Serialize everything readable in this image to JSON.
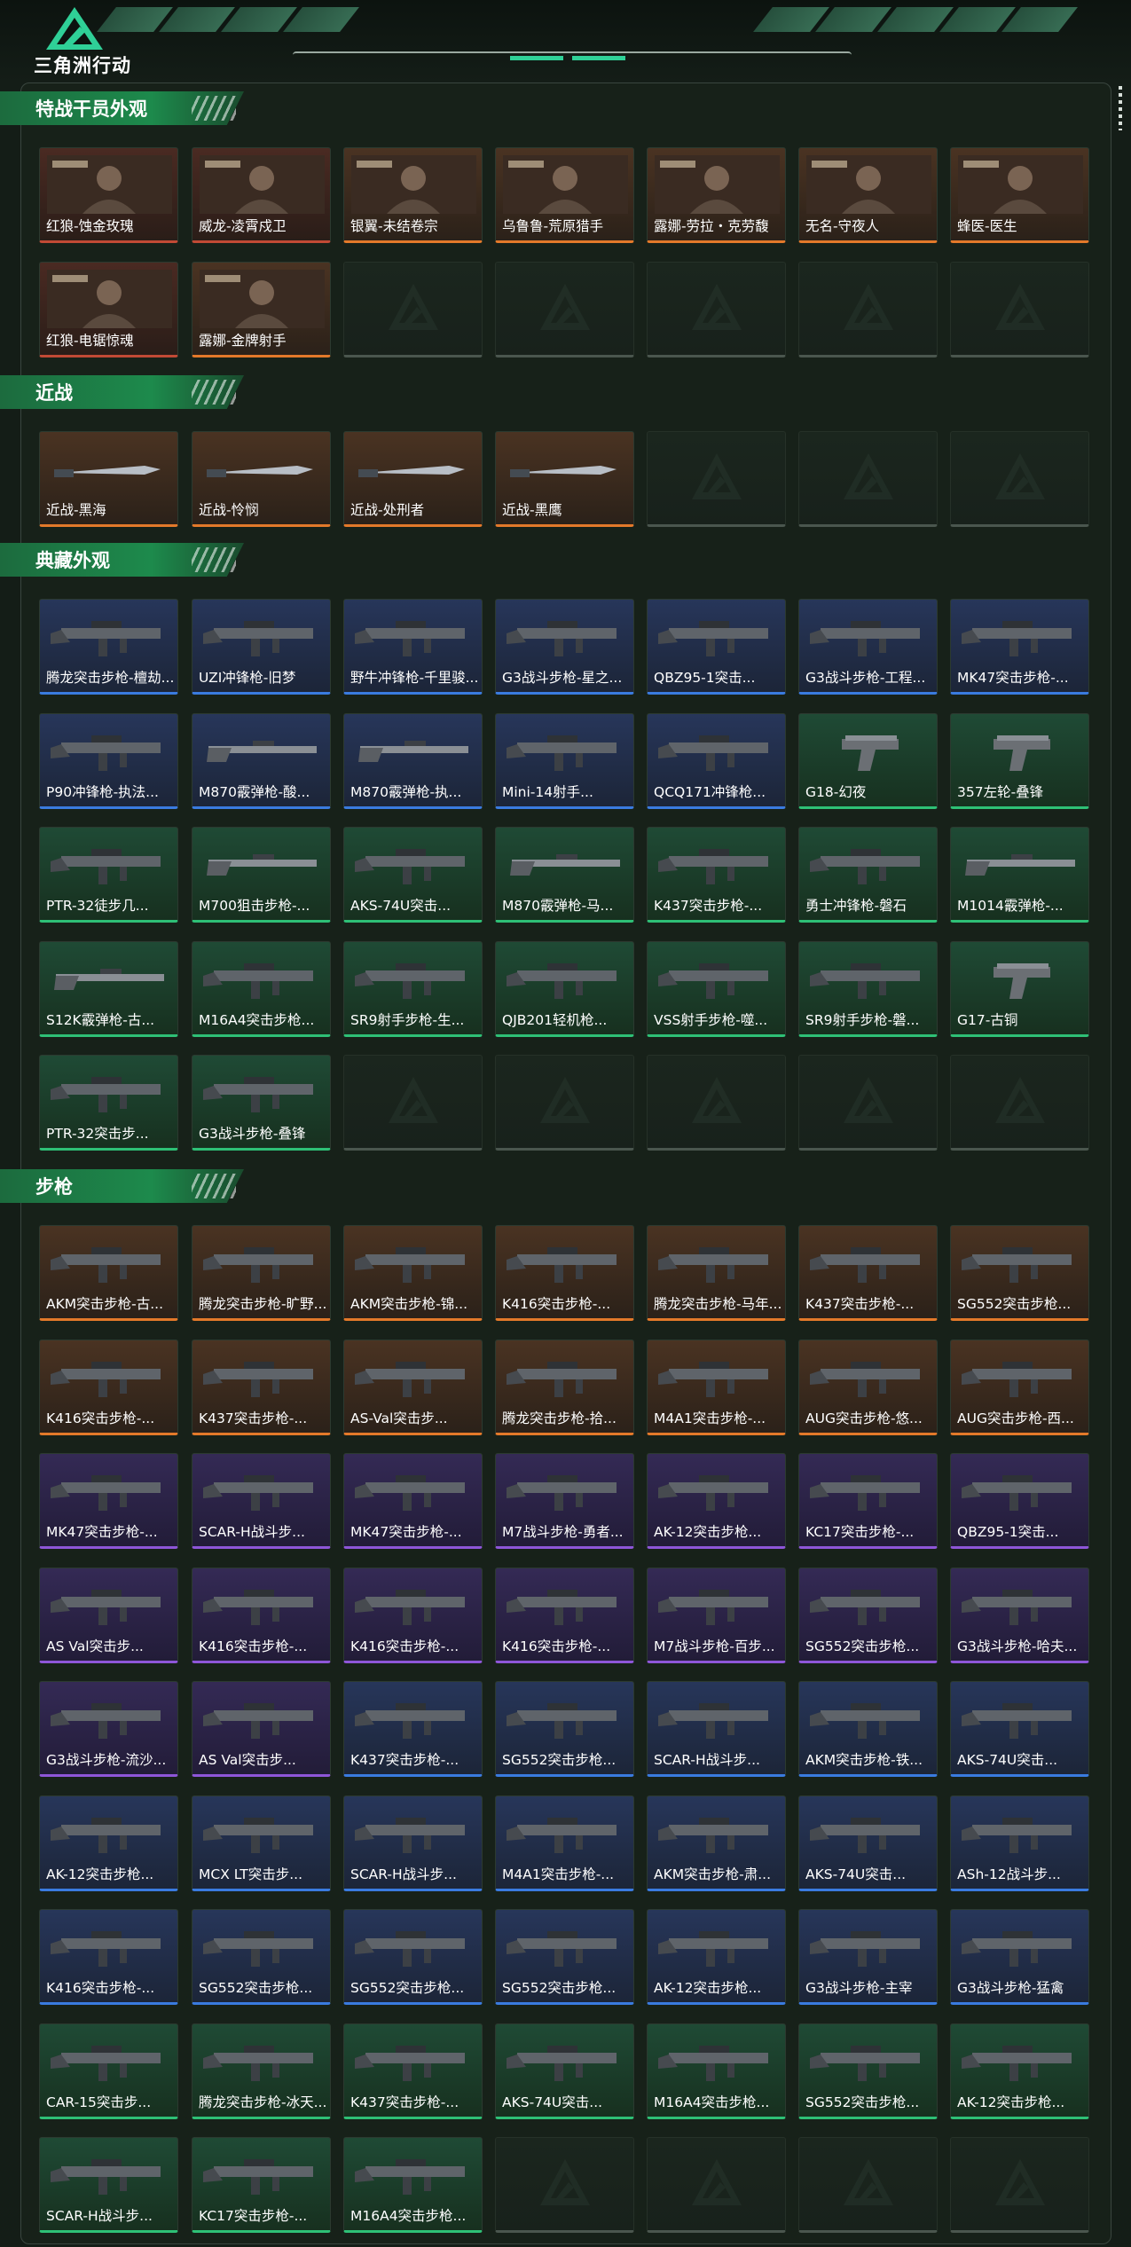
{
  "header": {
    "brand": "三角洲行动",
    "colors": {
      "accent": "#2fd097",
      "stripe": "#3e7b5f"
    }
  },
  "sections": [
    {
      "title": "特战干员外观",
      "columns": 7,
      "slots": 14,
      "items": [
        {
          "label": "红狼-蚀金玫瑰",
          "rarity": "red",
          "icon": "operator-portrait-icon"
        },
        {
          "label": "威龙-凌霄戍卫",
          "rarity": "red",
          "icon": "operator-portrait-icon"
        },
        {
          "label": "银翼-未结卷宗",
          "rarity": "orange",
          "icon": "operator-portrait-icon"
        },
        {
          "label": "乌鲁鲁-荒原猎手",
          "rarity": "orange",
          "icon": "operator-portrait-icon"
        },
        {
          "label": "露娜-劳拉・克劳馥",
          "rarity": "orange",
          "icon": "operator-portrait-icon"
        },
        {
          "label": "无名-守夜人",
          "rarity": "orange",
          "icon": "operator-portrait-icon"
        },
        {
          "label": "蜂医-医生",
          "rarity": "orange",
          "icon": "operator-portrait-icon"
        },
        {
          "label": "红狼-电锯惊魂",
          "rarity": "red",
          "icon": "operator-portrait-icon"
        },
        {
          "label": "露娜-金牌射手",
          "rarity": "orange",
          "icon": "operator-portrait-icon"
        }
      ]
    },
    {
      "title": "近战",
      "columns": 7,
      "slots": 7,
      "items": [
        {
          "label": "近战-黑海",
          "rarity": "orange",
          "icon": "melee-weapon-icon"
        },
        {
          "label": "近战-怜悯",
          "rarity": "orange",
          "icon": "melee-weapon-icon"
        },
        {
          "label": "近战-处刑者",
          "rarity": "orange",
          "icon": "melee-weapon-icon"
        },
        {
          "label": "近战-黑鹰",
          "rarity": "orange",
          "icon": "melee-weapon-icon"
        }
      ]
    },
    {
      "title": "典藏外观",
      "columns": 7,
      "slots": 35,
      "items": [
        {
          "label": "腾龙突击步枪-檀劫...",
          "rarity": "blue",
          "icon": "rifle-icon"
        },
        {
          "label": "UZI冲锋枪-旧梦",
          "rarity": "blue",
          "icon": "smg-icon"
        },
        {
          "label": "野牛冲锋枪-千里骏...",
          "rarity": "blue",
          "icon": "smg-icon"
        },
        {
          "label": "G3战斗步枪-星之...",
          "rarity": "blue",
          "icon": "rifle-icon"
        },
        {
          "label": "QBZ95-1突击...",
          "rarity": "blue",
          "icon": "rifle-icon"
        },
        {
          "label": "G3战斗步枪-工程...",
          "rarity": "blue",
          "icon": "rifle-icon"
        },
        {
          "label": "MK47突击步枪-...",
          "rarity": "blue",
          "icon": "rifle-icon"
        },
        {
          "label": "P90冲锋枪-执法...",
          "rarity": "blue",
          "icon": "smg-icon"
        },
        {
          "label": "M870霰弹枪-酸...",
          "rarity": "blue",
          "icon": "shotgun-icon"
        },
        {
          "label": "M870霰弹枪-执...",
          "rarity": "blue",
          "icon": "shotgun-icon"
        },
        {
          "label": "Mini-14射手...",
          "rarity": "blue",
          "icon": "rifle-icon"
        },
        {
          "label": "QCQ171冲锋枪...",
          "rarity": "blue",
          "icon": "smg-icon"
        },
        {
          "label": "G18-幻夜",
          "rarity": "green",
          "icon": "pistol-icon"
        },
        {
          "label": "357左轮-叠锋",
          "rarity": "green",
          "icon": "revolver-icon"
        },
        {
          "label": "PTR-32徒步几...",
          "rarity": "green",
          "icon": "rifle-icon"
        },
        {
          "label": "M700狙击步枪-...",
          "rarity": "green",
          "icon": "sniper-icon"
        },
        {
          "label": "AKS-74U突击...",
          "rarity": "green",
          "icon": "rifle-icon"
        },
        {
          "label": "M870霰弹枪-马...",
          "rarity": "green",
          "icon": "shotgun-icon"
        },
        {
          "label": "K437突击步枪-...",
          "rarity": "green",
          "icon": "rifle-icon"
        },
        {
          "label": "勇士冲锋枪-磐石",
          "rarity": "green",
          "icon": "smg-icon"
        },
        {
          "label": "M1014霰弹枪-...",
          "rarity": "green",
          "icon": "shotgun-icon"
        },
        {
          "label": "S12K霰弹枪-古...",
          "rarity": "green",
          "icon": "shotgun-icon"
        },
        {
          "label": "M16A4突击步枪...",
          "rarity": "green",
          "icon": "rifle-icon"
        },
        {
          "label": "SR9射手步枪-生...",
          "rarity": "green",
          "icon": "rifle-icon"
        },
        {
          "label": "QJB201轻机枪...",
          "rarity": "green",
          "icon": "lmg-icon"
        },
        {
          "label": "VSS射手步枪-噬...",
          "rarity": "green",
          "icon": "rifle-icon"
        },
        {
          "label": "SR9射手步枪-磐...",
          "rarity": "green",
          "icon": "rifle-icon"
        },
        {
          "label": "G17-古铜",
          "rarity": "green",
          "icon": "pistol-icon"
        },
        {
          "label": "PTR-32突击步...",
          "rarity": "green",
          "icon": "rifle-icon"
        },
        {
          "label": "G3战斗步枪-叠锋",
          "rarity": "green",
          "icon": "rifle-icon"
        }
      ]
    },
    {
      "title": "步枪",
      "columns": 7,
      "slots": 63,
      "items": [
        {
          "label": "AKM突击步枪-古...",
          "rarity": "orange",
          "icon": "rifle-icon"
        },
        {
          "label": "腾龙突击步枪-旷野...",
          "rarity": "orange",
          "icon": "rifle-icon"
        },
        {
          "label": "AKM突击步枪-锦...",
          "rarity": "orange",
          "icon": "rifle-icon"
        },
        {
          "label": "K416突击步枪-...",
          "rarity": "orange",
          "icon": "rifle-icon"
        },
        {
          "label": "腾龙突击步枪-马年...",
          "rarity": "orange",
          "icon": "rifle-icon"
        },
        {
          "label": "K437突击步枪-...",
          "rarity": "orange",
          "icon": "rifle-icon"
        },
        {
          "label": "SG552突击步枪...",
          "rarity": "orange",
          "icon": "rifle-icon"
        },
        {
          "label": "K416突击步枪-...",
          "rarity": "orange",
          "icon": "rifle-icon"
        },
        {
          "label": "K437突击步枪-...",
          "rarity": "orange",
          "icon": "rifle-icon"
        },
        {
          "label": "AS-Val突击步...",
          "rarity": "orange",
          "icon": "rifle-icon"
        },
        {
          "label": "腾龙突击步枪-拾...",
          "rarity": "orange",
          "icon": "rifle-icon"
        },
        {
          "label": "M4A1突击步枪-...",
          "rarity": "orange",
          "icon": "rifle-icon"
        },
        {
          "label": "AUG突击步枪-悠...",
          "rarity": "orange",
          "icon": "rifle-icon"
        },
        {
          "label": "AUG突击步枪-西...",
          "rarity": "orange",
          "icon": "rifle-icon"
        },
        {
          "label": "MK47突击步枪-...",
          "rarity": "purple",
          "icon": "rifle-icon"
        },
        {
          "label": "SCAR-H战斗步...",
          "rarity": "purple",
          "icon": "rifle-icon"
        },
        {
          "label": "MK47突击步枪-...",
          "rarity": "purple",
          "icon": "rifle-icon"
        },
        {
          "label": "M7战斗步枪-勇者...",
          "rarity": "purple",
          "icon": "rifle-icon"
        },
        {
          "label": "AK-12突击步枪...",
          "rarity": "purple",
          "icon": "rifle-icon"
        },
        {
          "label": "KC17突击步枪-...",
          "rarity": "purple",
          "icon": "rifle-icon"
        },
        {
          "label": "QBZ95-1突击...",
          "rarity": "purple",
          "icon": "rifle-icon"
        },
        {
          "label": "AS Val突击步...",
          "rarity": "purple",
          "icon": "rifle-icon"
        },
        {
          "label": "K416突击步枪-...",
          "rarity": "purple",
          "icon": "rifle-icon"
        },
        {
          "label": "K416突击步枪-...",
          "rarity": "purple",
          "icon": "rifle-icon"
        },
        {
          "label": "K416突击步枪-...",
          "rarity": "purple",
          "icon": "rifle-icon"
        },
        {
          "label": "M7战斗步枪-百步...",
          "rarity": "purple",
          "icon": "rifle-icon"
        },
        {
          "label": "SG552突击步枪...",
          "rarity": "purple",
          "icon": "rifle-icon"
        },
        {
          "label": "G3战斗步枪-哈夫...",
          "rarity": "purple",
          "icon": "rifle-icon"
        },
        {
          "label": "G3战斗步枪-流沙...",
          "rarity": "purple",
          "icon": "rifle-icon"
        },
        {
          "label": "AS Val突击步...",
          "rarity": "purple",
          "icon": "rifle-icon"
        },
        {
          "label": "K437突击步枪-...",
          "rarity": "blue",
          "icon": "rifle-icon"
        },
        {
          "label": "SG552突击步枪...",
          "rarity": "blue",
          "icon": "rifle-icon"
        },
        {
          "label": "SCAR-H战斗步...",
          "rarity": "blue",
          "icon": "rifle-icon"
        },
        {
          "label": "AKM突击步枪-铁...",
          "rarity": "blue",
          "icon": "rifle-icon"
        },
        {
          "label": "AKS-74U突击...",
          "rarity": "blue",
          "icon": "rifle-icon"
        },
        {
          "label": "AK-12突击步枪...",
          "rarity": "blue",
          "icon": "rifle-icon"
        },
        {
          "label": "MCX LT突击步...",
          "rarity": "blue",
          "icon": "rifle-icon"
        },
        {
          "label": "SCAR-H战斗步...",
          "rarity": "blue",
          "icon": "rifle-icon"
        },
        {
          "label": "M4A1突击步枪-...",
          "rarity": "blue",
          "icon": "rifle-icon"
        },
        {
          "label": "AKM突击步枪-肃...",
          "rarity": "blue",
          "icon": "rifle-icon"
        },
        {
          "label": "AKS-74U突击...",
          "rarity": "blue",
          "icon": "rifle-icon"
        },
        {
          "label": "ASh-12战斗步...",
          "rarity": "blue",
          "icon": "rifle-icon"
        },
        {
          "label": "K416突击步枪-...",
          "rarity": "blue",
          "icon": "rifle-icon"
        },
        {
          "label": "SG552突击步枪...",
          "rarity": "blue",
          "icon": "rifle-icon"
        },
        {
          "label": "SG552突击步枪...",
          "rarity": "blue",
          "icon": "rifle-icon"
        },
        {
          "label": "SG552突击步枪...",
          "rarity": "blue",
          "icon": "rifle-icon"
        },
        {
          "label": "AK-12突击步枪...",
          "rarity": "blue",
          "icon": "rifle-icon"
        },
        {
          "label": "G3战斗步枪-主宰",
          "rarity": "blue",
          "icon": "rifle-icon"
        },
        {
          "label": "G3战斗步枪-猛禽",
          "rarity": "blue",
          "icon": "rifle-icon"
        },
        {
          "label": "CAR-15突击步...",
          "rarity": "green",
          "icon": "rifle-icon"
        },
        {
          "label": "腾龙突击步枪-冰天...",
          "rarity": "green",
          "icon": "rifle-icon"
        },
        {
          "label": "K437突击步枪-...",
          "rarity": "green",
          "icon": "rifle-icon"
        },
        {
          "label": "AKS-74U突击...",
          "rarity": "green",
          "icon": "rifle-icon"
        },
        {
          "label": "M16A4突击步枪...",
          "rarity": "green",
          "icon": "rifle-icon"
        },
        {
          "label": "SG552突击步枪...",
          "rarity": "green",
          "icon": "rifle-icon"
        },
        {
          "label": "AK-12突击步枪...",
          "rarity": "green",
          "icon": "rifle-icon"
        },
        {
          "label": "SCAR-H战斗步...",
          "rarity": "green",
          "icon": "rifle-icon"
        },
        {
          "label": "KC17突击步枪-...",
          "rarity": "green",
          "icon": "rifle-icon"
        },
        {
          "label": "M16A4突击步枪...",
          "rarity": "green",
          "icon": "rifle-icon"
        }
      ]
    }
  ]
}
